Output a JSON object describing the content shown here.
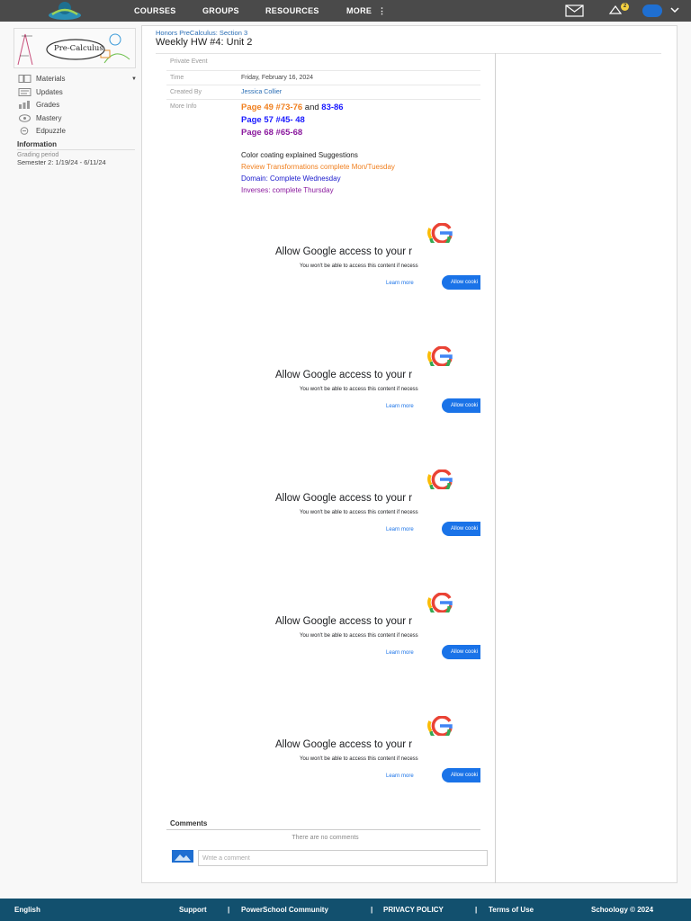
{
  "nav": {
    "items": [
      "COURSES",
      "GROUPS",
      "RESOURCES",
      "MORE"
    ],
    "more_glyph": "⋮",
    "notification_count": "2"
  },
  "sidebar": {
    "course_image_text": "Pre-Calculus",
    "items": [
      {
        "label": "Materials",
        "icon": "materials-icon"
      },
      {
        "label": "Updates",
        "icon": "updates-icon"
      },
      {
        "label": "Grades",
        "icon": "grades-icon"
      },
      {
        "label": "Mastery",
        "icon": "mastery-icon"
      },
      {
        "label": "Edpuzzle",
        "icon": "edpuzzle-icon"
      }
    ],
    "info_heading": "Information",
    "grading_label": "Grading period",
    "grading_value": "Semester 2: 1/19/24 - 6/11/24"
  },
  "event": {
    "breadcrumb": "Honors PreCalculus: Section 3",
    "title": "Weekly HW #4: Unit 2",
    "private_label": "Private Event",
    "time_label": "Time",
    "time_value": "Friday, February 16, 2024",
    "created_label": "Created By",
    "created_value": "Jessica Collier",
    "more_label": "More Info",
    "pages": [
      {
        "a": "Page 49 #73-76",
        "and": "and",
        "b": "83-86"
      },
      {
        "a": "Page 57 #45- 48"
      },
      {
        "a": "Page 68 #65-68"
      }
    ],
    "notes": [
      "Color coating explained Suggestions",
      "Review Transformations complete Mon/Tuesday",
      "Domain: Complete Wednesday",
      "Inverses: complete Thursday"
    ]
  },
  "google_prompt": {
    "title": "Allow Google access to your r",
    "subtitle": "You won't be able to access this content if necess",
    "learn_more": "Learn more",
    "allow_button": "Allow cooki"
  },
  "comments": {
    "heading": "Comments",
    "empty_text": "There are no comments",
    "input_placeholder": "Write a comment"
  },
  "footer": {
    "language": "English",
    "support": "Support",
    "community": "PowerSchool Community",
    "privacy": "PRIVACY POLICY",
    "terms": "Terms of Use",
    "brand": "Schoology © 2024",
    "sep": "|"
  },
  "colors": {
    "nav_bg": "#4a4a4a",
    "footer_bg": "#12506e",
    "page_orange": "#f07f1e",
    "page_blue": "#1a1aff",
    "page_purple": "#8b1a9e",
    "note_orange": "#f07f1e",
    "note_blue": "#1a1acc",
    "note_purple": "#8b1a9e",
    "google_blue": "#1a73e8"
  }
}
